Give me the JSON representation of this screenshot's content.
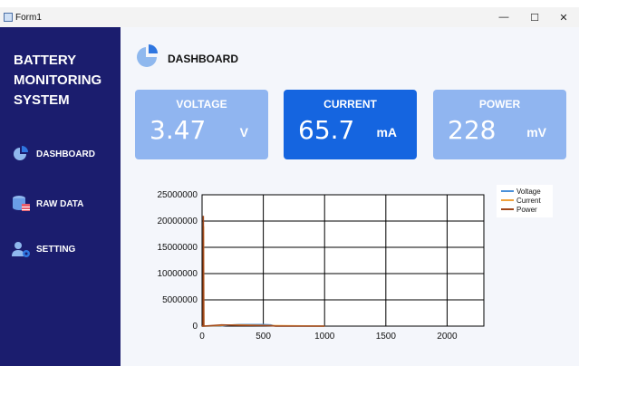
{
  "window": {
    "title": "Form1",
    "minimize_symbol": "—",
    "maximize_symbol": "☐",
    "close_symbol": "✕"
  },
  "sidebar": {
    "brand": [
      "BATTERY",
      "MONITORING",
      "SYSTEM"
    ],
    "items": [
      {
        "label": "DASHBOARD",
        "icon": "pie-chart-icon"
      },
      {
        "label": "RAW DATA",
        "icon": "database-icon"
      },
      {
        "label": "SETTING",
        "icon": "user-gear-icon"
      }
    ]
  },
  "header": {
    "title": "DASHBOARD",
    "icon": "pie-chart-icon"
  },
  "cards": [
    {
      "label": "VOLTAGE",
      "value": "3.47",
      "unit": "V",
      "color": "#90b5f0"
    },
    {
      "label": "CURRENT",
      "value": "65.7",
      "unit": "mA",
      "color": "#1565e0"
    },
    {
      "label": "POWER",
      "value": "228",
      "unit": "mV",
      "color": "#90b5f0"
    }
  ],
  "colors": {
    "sidebar": "#1b1d6e",
    "background": "#f4f6fb",
    "accent": "#1565e0"
  },
  "chart_data": {
    "type": "line",
    "xlim": [
      0,
      2300
    ],
    "ylim": [
      0,
      25000000
    ],
    "xticks": [
      0,
      500,
      1000,
      1500,
      2000
    ],
    "yticks": [
      0,
      5000000,
      10000000,
      15000000,
      20000000,
      25000000
    ],
    "xtick_labels": [
      "0",
      "500",
      "1000",
      "1500",
      "2000"
    ],
    "ytick_labels": [
      "0",
      "5000000",
      "10000000",
      "15000000",
      "20000000",
      "25000000"
    ],
    "grid": true,
    "legend_position": "top-right",
    "series": [
      {
        "name": "Voltage",
        "color": "#4a90d9",
        "x": [
          0,
          150,
          200,
          300,
          400,
          500,
          560,
          600,
          900,
          1000
        ],
        "y": [
          0,
          0,
          150000,
          300000,
          300000,
          300000,
          250000,
          0,
          0,
          0
        ]
      },
      {
        "name": "Current",
        "color": "#f0a23c",
        "x": [
          0,
          10,
          12,
          15,
          150,
          200,
          300,
          560,
          1000
        ],
        "y": [
          0,
          0,
          19000000,
          0,
          80000,
          200000,
          250000,
          100000,
          0
        ]
      },
      {
        "name": "Power",
        "color": "#a0471a",
        "x": [
          0,
          8,
          10,
          14,
          160,
          300,
          500,
          560,
          600,
          800,
          1000
        ],
        "y": [
          0,
          0,
          21000000,
          0,
          250000,
          150000,
          100000,
          80000,
          0,
          0,
          0
        ]
      }
    ]
  }
}
